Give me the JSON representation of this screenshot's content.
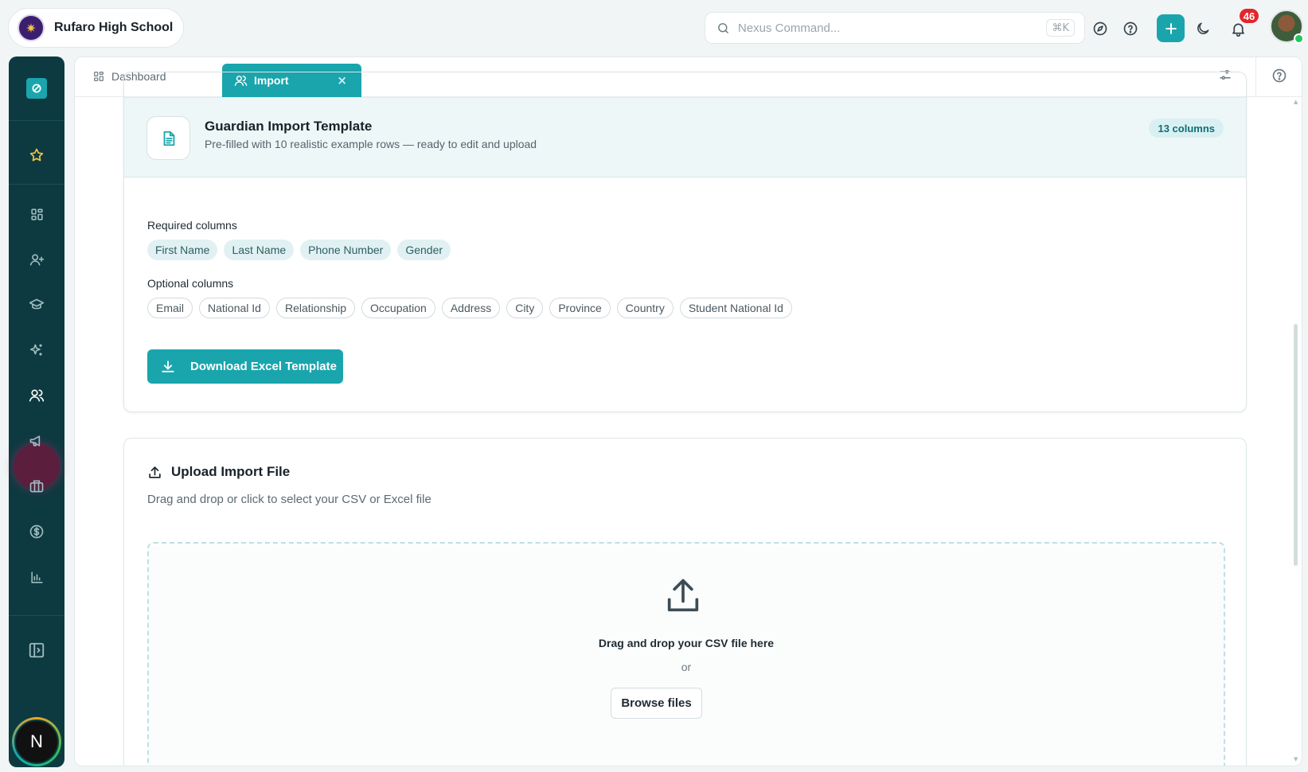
{
  "app": {
    "school_name": "Rufaro High School",
    "search_placeholder": "Nexus Command...",
    "search_shortcut": "⌘K",
    "notification_count": "46",
    "user_initial": "N"
  },
  "tabs": {
    "dashboard": "Dashboard",
    "import": "Import",
    "close": "×"
  },
  "template_card": {
    "title": "Guardian Import Template",
    "subtitle": "Pre-filled with 10 realistic example rows — ready to edit and upload",
    "column_badge": "13 columns",
    "required_label": "Required columns",
    "required_columns": [
      "First Name",
      "Last Name",
      "Phone Number",
      "Gender"
    ],
    "optional_label": "Optional columns",
    "optional_columns": [
      "Email",
      "National Id",
      "Relationship",
      "Occupation",
      "Address",
      "City",
      "Province",
      "Country",
      "Student National Id"
    ],
    "download_label": "Download Excel Template"
  },
  "upload_card": {
    "title": "Upload Import File",
    "subtitle": "Drag and drop or click to select your CSV or Excel file",
    "drop_text": "Drag and drop your CSV file here",
    "or_text": "or",
    "browse_label": "Browse files"
  },
  "colors": {
    "accent": "#1aa5ad",
    "rail": "#0d3a40",
    "badge": "#e3262d"
  }
}
